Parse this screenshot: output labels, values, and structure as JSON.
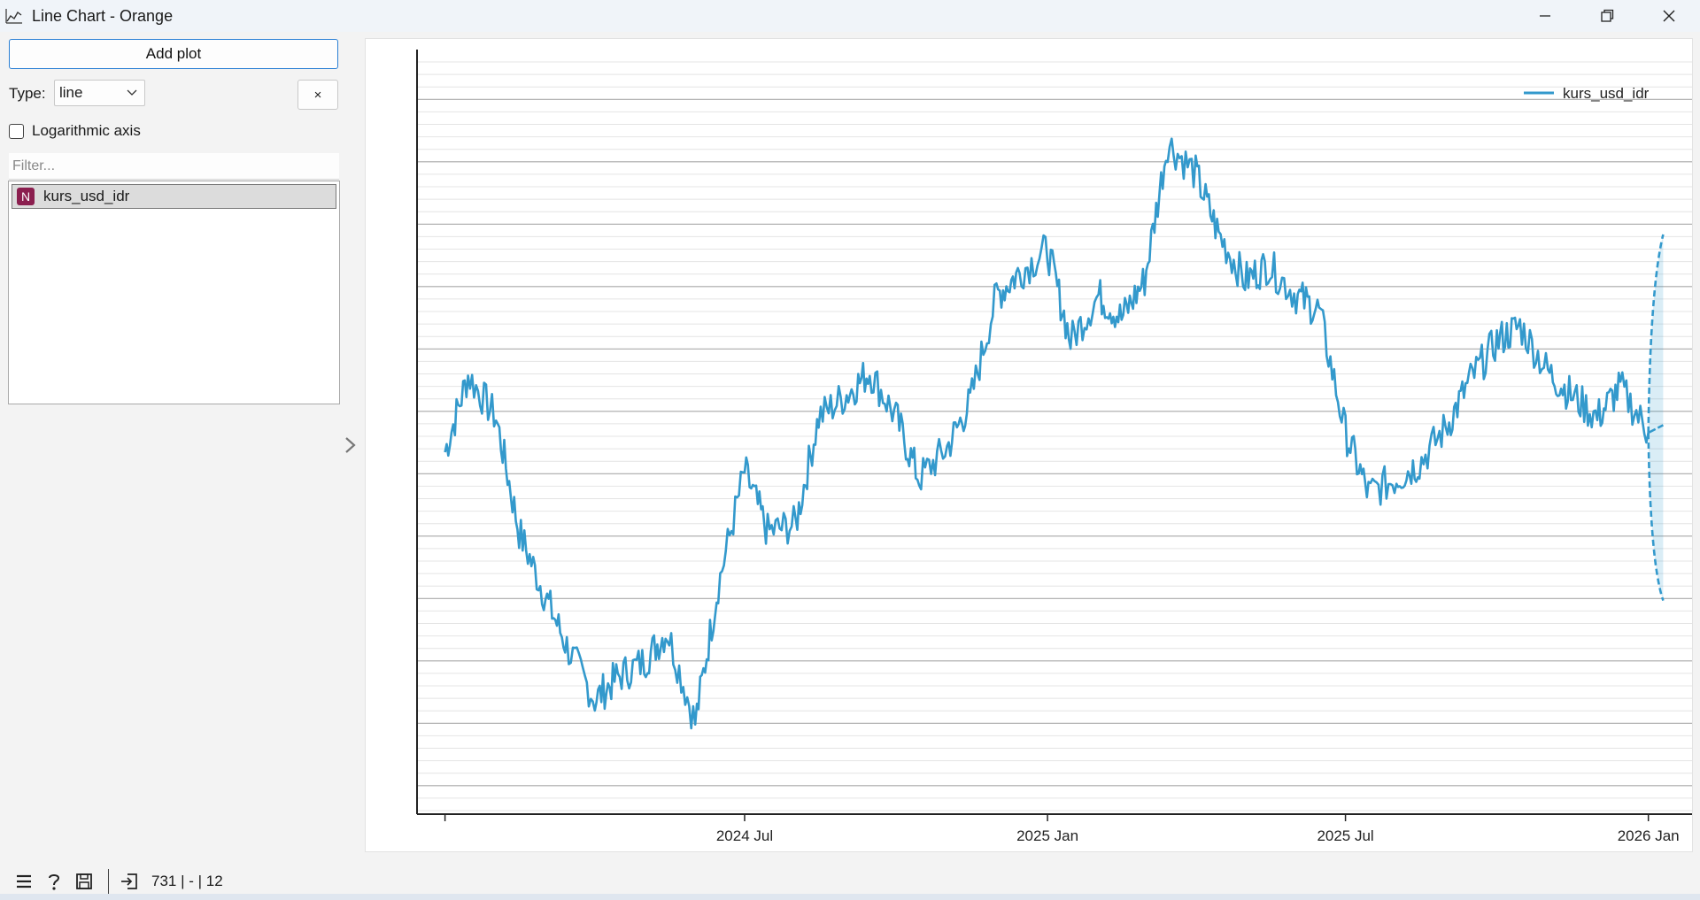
{
  "window": {
    "title": "Line Chart - Orange",
    "icon": "line-chart-icon",
    "controls": [
      "minimize-icon",
      "restore-icon",
      "close-icon"
    ]
  },
  "controls": {
    "add_plot_label": "Add plot",
    "type_label": "Type:",
    "type_value": "line",
    "remove_label": "×",
    "log_axis_label": "Logarithmic axis",
    "log_axis_checked": false,
    "filter_placeholder": "Filter...",
    "variables": [
      {
        "badge": "N",
        "name": "kurs_usd_idr",
        "selected": true
      }
    ]
  },
  "chart_data": {
    "type": "line",
    "title": "",
    "xlabel": "",
    "ylabel": "",
    "x_ticks": [
      "2024 Jul",
      "2025 Jan",
      "2025 Jul",
      "2026 Jan"
    ],
    "y_tick_labels_visible": false,
    "grid": true,
    "legend_position": "top-right",
    "series": [
      {
        "name": "kurs_usd_idr",
        "color": "#3399cc",
        "x": [
          "2024-01-01",
          "2024-01-15",
          "2024-02-01",
          "2024-02-15",
          "2024-03-01",
          "2024-03-15",
          "2024-04-01",
          "2024-04-15",
          "2024-05-01",
          "2024-05-15",
          "2024-06-01",
          "2024-06-15",
          "2024-07-01",
          "2024-07-15",
          "2024-08-01",
          "2024-08-15",
          "2024-09-01",
          "2024-09-15",
          "2024-10-01",
          "2024-10-15",
          "2024-11-01",
          "2024-11-15",
          "2024-12-01",
          "2024-12-15",
          "2025-01-01",
          "2025-01-15",
          "2025-02-01",
          "2025-02-15",
          "2025-03-01",
          "2025-03-15",
          "2025-04-01",
          "2025-04-15",
          "2025-05-01",
          "2025-05-15",
          "2025-06-01",
          "2025-06-15",
          "2025-07-01",
          "2025-07-15",
          "2025-08-01",
          "2025-08-15",
          "2025-09-01",
          "2025-09-15",
          "2025-10-01",
          "2025-10-15",
          "2025-11-01",
          "2025-11-15",
          "2025-12-01",
          "2025-12-15",
          "2026-01-01"
        ],
        "y": [
          47.5,
          57.5,
          52,
          37,
          29,
          22,
          15,
          18,
          20,
          24,
          12,
          30,
          45,
          37,
          38,
          52,
          55,
          58,
          52,
          44,
          48,
          54,
          68,
          71,
          74,
          62,
          68,
          65,
          70,
          88,
          84,
          76,
          70,
          72,
          68,
          66,
          50,
          42,
          44,
          46,
          51,
          57,
          62,
          64,
          58,
          55,
          52,
          56,
          50
        ]
      }
    ],
    "forecast": {
      "center": [
        50,
        51
      ],
      "upper": [
        50,
        76
      ],
      "lower": [
        50,
        28
      ]
    },
    "ylim": [
      0,
      100
    ]
  },
  "statusbar": {
    "icons": [
      "menu-icon",
      "help-icon",
      "save-icon",
      "input-icon"
    ],
    "text": "731 | - | 12"
  }
}
